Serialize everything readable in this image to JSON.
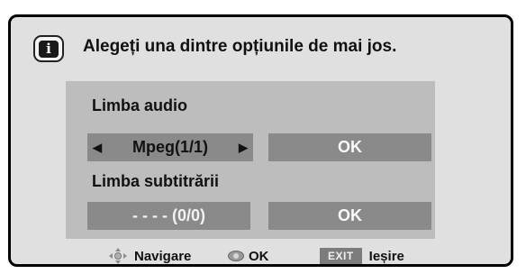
{
  "dialog": {
    "title": "Alegeți una dintre opțiunile de mai jos.",
    "icon": "info-icon"
  },
  "audio": {
    "label": "Limba audio",
    "value": "Mpeg(1/1)",
    "ok_label": "OK"
  },
  "subtitle": {
    "label": "Limba subtitrării",
    "value": "- - - - (0/0)",
    "ok_label": "OK"
  },
  "footer": {
    "navigate_label": "Navigare",
    "ok_label": "OK",
    "exit_key": "EXIT",
    "exit_label": "Ieșire"
  },
  "colors": {
    "dialog_bg": "#e0e0e0",
    "panel_bg": "#bdbdbd",
    "field_bg": "#8a8a8a"
  }
}
